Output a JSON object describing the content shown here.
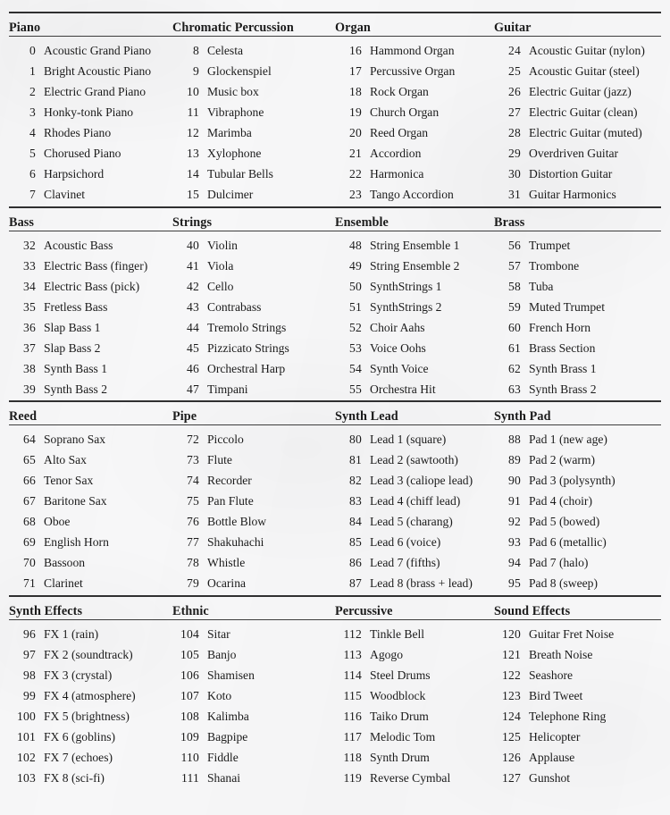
{
  "document": {
    "type": "general-midi-instrument-patch-map",
    "page_background_color": "#f7f7f8",
    "ink_color": "#1b1b1b",
    "column_count": 4,
    "rows_per_block": 8,
    "block_count": 4,
    "rule_color": "#141414"
  },
  "blocks": [
    {
      "headers": [
        "Piano",
        "Chromatic Percussion",
        "Organ",
        "Guitar"
      ],
      "columns": [
        {
          "header": "Piano",
          "entries": [
            {
              "num": "0",
              "name": "Acoustic Grand Piano"
            },
            {
              "num": "1",
              "name": "Bright Acoustic Piano"
            },
            {
              "num": "2",
              "name": "Electric Grand Piano"
            },
            {
              "num": "3",
              "name": "Honky-tonk Piano"
            },
            {
              "num": "4",
              "name": "Rhodes Piano"
            },
            {
              "num": "5",
              "name": "Chorused Piano"
            },
            {
              "num": "6",
              "name": "Harpsichord"
            },
            {
              "num": "7",
              "name": "Clavinet"
            }
          ]
        },
        {
          "header": "Chromatic Percussion",
          "entries": [
            {
              "num": "8",
              "name": "Celesta"
            },
            {
              "num": "9",
              "name": "Glockenspiel"
            },
            {
              "num": "10",
              "name": "Music box"
            },
            {
              "num": "11",
              "name": "Vibraphone"
            },
            {
              "num": "12",
              "name": "Marimba"
            },
            {
              "num": "13",
              "name": "Xylophone"
            },
            {
              "num": "14",
              "name": "Tubular Bells"
            },
            {
              "num": "15",
              "name": "Dulcimer"
            }
          ]
        },
        {
          "header": "Organ",
          "entries": [
            {
              "num": "16",
              "name": "Hammond Organ"
            },
            {
              "num": "17",
              "name": "Percussive Organ"
            },
            {
              "num": "18",
              "name": "Rock Organ"
            },
            {
              "num": "19",
              "name": "Church Organ"
            },
            {
              "num": "20",
              "name": "Reed Organ"
            },
            {
              "num": "21",
              "name": "Accordion"
            },
            {
              "num": "22",
              "name": "Harmonica"
            },
            {
              "num": "23",
              "name": "Tango Accordion"
            }
          ]
        },
        {
          "header": "Guitar",
          "entries": [
            {
              "num": "24",
              "name": "Acoustic Guitar (nylon)"
            },
            {
              "num": "25",
              "name": "Acoustic Guitar (steel)"
            },
            {
              "num": "26",
              "name": "Electric Guitar (jazz)"
            },
            {
              "num": "27",
              "name": "Electric Guitar (clean)"
            },
            {
              "num": "28",
              "name": "Electric Guitar (muted)"
            },
            {
              "num": "29",
              "name": "Overdriven Guitar"
            },
            {
              "num": "30",
              "name": "Distortion Guitar"
            },
            {
              "num": "31",
              "name": "Guitar Harmonics"
            }
          ]
        }
      ]
    },
    {
      "headers": [
        "Bass",
        "Strings",
        "Ensemble",
        "Brass"
      ],
      "columns": [
        {
          "header": "Bass",
          "entries": [
            {
              "num": "32",
              "name": "Acoustic Bass"
            },
            {
              "num": "33",
              "name": "Electric Bass (finger)"
            },
            {
              "num": "34",
              "name": "Electric Bass (pick)"
            },
            {
              "num": "35",
              "name": "Fretless Bass"
            },
            {
              "num": "36",
              "name": "Slap Bass 1"
            },
            {
              "num": "37",
              "name": "Slap Bass 2"
            },
            {
              "num": "38",
              "name": "Synth Bass 1"
            },
            {
              "num": "39",
              "name": "Synth Bass 2"
            }
          ]
        },
        {
          "header": "Strings",
          "entries": [
            {
              "num": "40",
              "name": "Violin"
            },
            {
              "num": "41",
              "name": "Viola"
            },
            {
              "num": "42",
              "name": "Cello"
            },
            {
              "num": "43",
              "name": "Contrabass"
            },
            {
              "num": "44",
              "name": "Tremolo Strings"
            },
            {
              "num": "45",
              "name": "Pizzicato Strings"
            },
            {
              "num": "46",
              "name": "Orchestral Harp"
            },
            {
              "num": "47",
              "name": "Timpani"
            }
          ]
        },
        {
          "header": "Ensemble",
          "entries": [
            {
              "num": "48",
              "name": "String Ensemble 1"
            },
            {
              "num": "49",
              "name": "String Ensemble 2"
            },
            {
              "num": "50",
              "name": "SynthStrings 1"
            },
            {
              "num": "51",
              "name": "SynthStrings 2"
            },
            {
              "num": "52",
              "name": "Choir Aahs"
            },
            {
              "num": "53",
              "name": "Voice Oohs"
            },
            {
              "num": "54",
              "name": "Synth Voice"
            },
            {
              "num": "55",
              "name": "Orchestra Hit"
            }
          ]
        },
        {
          "header": "Brass",
          "entries": [
            {
              "num": "56",
              "name": "Trumpet"
            },
            {
              "num": "57",
              "name": "Trombone"
            },
            {
              "num": "58",
              "name": "Tuba"
            },
            {
              "num": "59",
              "name": "Muted Trumpet"
            },
            {
              "num": "60",
              "name": "French Horn"
            },
            {
              "num": "61",
              "name": "Brass Section"
            },
            {
              "num": "62",
              "name": "Synth Brass 1"
            },
            {
              "num": "63",
              "name": "Synth Brass 2"
            }
          ]
        }
      ]
    },
    {
      "headers": [
        "Reed",
        "Pipe",
        "Synth Lead",
        "Synth Pad"
      ],
      "columns": [
        {
          "header": "Reed",
          "entries": [
            {
              "num": "64",
              "name": "Soprano Sax"
            },
            {
              "num": "65",
              "name": "Alto Sax"
            },
            {
              "num": "66",
              "name": "Tenor Sax"
            },
            {
              "num": "67",
              "name": "Baritone Sax"
            },
            {
              "num": "68",
              "name": "Oboe"
            },
            {
              "num": "69",
              "name": "English Horn"
            },
            {
              "num": "70",
              "name": "Bassoon"
            },
            {
              "num": "71",
              "name": "Clarinet"
            }
          ]
        },
        {
          "header": "Pipe",
          "entries": [
            {
              "num": "72",
              "name": "Piccolo"
            },
            {
              "num": "73",
              "name": "Flute"
            },
            {
              "num": "74",
              "name": "Recorder"
            },
            {
              "num": "75",
              "name": "Pan Flute"
            },
            {
              "num": "76",
              "name": "Bottle Blow"
            },
            {
              "num": "77",
              "name": "Shakuhachi"
            },
            {
              "num": "78",
              "name": "Whistle"
            },
            {
              "num": "79",
              "name": "Ocarina"
            }
          ]
        },
        {
          "header": "Synth Lead",
          "entries": [
            {
              "num": "80",
              "name": "Lead 1 (square)"
            },
            {
              "num": "81",
              "name": "Lead 2 (sawtooth)"
            },
            {
              "num": "82",
              "name": "Lead 3 (caliope lead)"
            },
            {
              "num": "83",
              "name": "Lead 4 (chiff lead)"
            },
            {
              "num": "84",
              "name": "Lead 5 (charang)"
            },
            {
              "num": "85",
              "name": "Lead 6 (voice)"
            },
            {
              "num": "86",
              "name": "Lead 7 (fifths)"
            },
            {
              "num": "87",
              "name": "Lead 8 (brass + lead)"
            }
          ]
        },
        {
          "header": "Synth Pad",
          "entries": [
            {
              "num": "88",
              "name": "Pad 1 (new age)"
            },
            {
              "num": "89",
              "name": "Pad 2 (warm)"
            },
            {
              "num": "90",
              "name": "Pad 3 (polysynth)"
            },
            {
              "num": "91",
              "name": "Pad 4 (choir)"
            },
            {
              "num": "92",
              "name": "Pad 5 (bowed)"
            },
            {
              "num": "93",
              "name": "Pad 6 (metallic)"
            },
            {
              "num": "94",
              "name": "Pad 7 (halo)"
            },
            {
              "num": "95",
              "name": "Pad 8 (sweep)"
            }
          ]
        }
      ]
    },
    {
      "headers": [
        "Synth Effects",
        "Ethnic",
        "Percussive",
        "Sound Effects"
      ],
      "columns": [
        {
          "header": "Synth Effects",
          "entries": [
            {
              "num": "96",
              "name": "FX 1 (rain)"
            },
            {
              "num": "97",
              "name": "FX 2 (soundtrack)"
            },
            {
              "num": "98",
              "name": "FX 3 (crystal)"
            },
            {
              "num": "99",
              "name": "FX 4 (atmosphere)"
            },
            {
              "num": "100",
              "name": "FX 5 (brightness)"
            },
            {
              "num": "101",
              "name": "FX 6 (goblins)"
            },
            {
              "num": "102",
              "name": "FX 7 (echoes)"
            },
            {
              "num": "103",
              "name": "FX 8 (sci-fi)"
            }
          ]
        },
        {
          "header": "Ethnic",
          "entries": [
            {
              "num": "104",
              "name": "Sitar"
            },
            {
              "num": "105",
              "name": "Banjo"
            },
            {
              "num": "106",
              "name": "Shamisen"
            },
            {
              "num": "107",
              "name": "Koto"
            },
            {
              "num": "108",
              "name": "Kalimba"
            },
            {
              "num": "109",
              "name": "Bagpipe"
            },
            {
              "num": "110",
              "name": "Fiddle"
            },
            {
              "num": "111",
              "name": "Shanai"
            }
          ]
        },
        {
          "header": "Percussive",
          "entries": [
            {
              "num": "112",
              "name": "Tinkle Bell"
            },
            {
              "num": "113",
              "name": "Agogo"
            },
            {
              "num": "114",
              "name": "Steel Drums"
            },
            {
              "num": "115",
              "name": "Woodblock"
            },
            {
              "num": "116",
              "name": "Taiko Drum"
            },
            {
              "num": "117",
              "name": "Melodic Tom"
            },
            {
              "num": "118",
              "name": "Synth Drum"
            },
            {
              "num": "119",
              "name": "Reverse Cymbal"
            }
          ]
        },
        {
          "header": "Sound Effects",
          "entries": [
            {
              "num": "120",
              "name": "Guitar Fret Noise"
            },
            {
              "num": "121",
              "name": "Breath Noise"
            },
            {
              "num": "122",
              "name": "Seashore"
            },
            {
              "num": "123",
              "name": "Bird Tweet"
            },
            {
              "num": "124",
              "name": "Telephone Ring"
            },
            {
              "num": "125",
              "name": "Helicopter"
            },
            {
              "num": "126",
              "name": "Applause"
            },
            {
              "num": "127",
              "name": "Gunshot"
            }
          ]
        }
      ]
    }
  ]
}
